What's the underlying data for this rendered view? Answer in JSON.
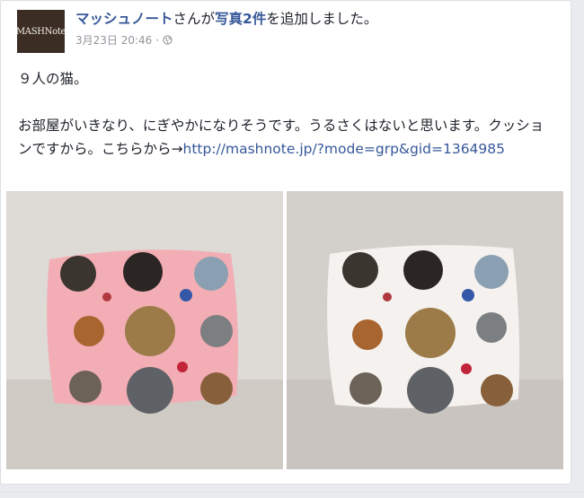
{
  "post": {
    "author": "マッシュノート",
    "avatar_text": "MASHNote",
    "action_prefix": "さんが",
    "photos_link": "写真2件",
    "action_suffix": "を追加しました。",
    "timestamp": "3月23日 20:46",
    "separator": "·",
    "privacy_icon": "globe-icon",
    "line1": "９人の猫。",
    "line2": "お部屋がいきなり、にぎやかになりそうです。うるさくはないと思います。クッションですから。こちらから→",
    "link_text": "http://mashnote.jp/?mode=grp&gid=1364985"
  },
  "photos": [
    {
      "name": "pink cushion",
      "bg": "#f2aeb4"
    },
    {
      "name": "white cushion",
      "bg": "#f4f1ee"
    }
  ],
  "colors": {
    "link": "#365899",
    "text": "#1d2129",
    "meta": "#90949c"
  }
}
